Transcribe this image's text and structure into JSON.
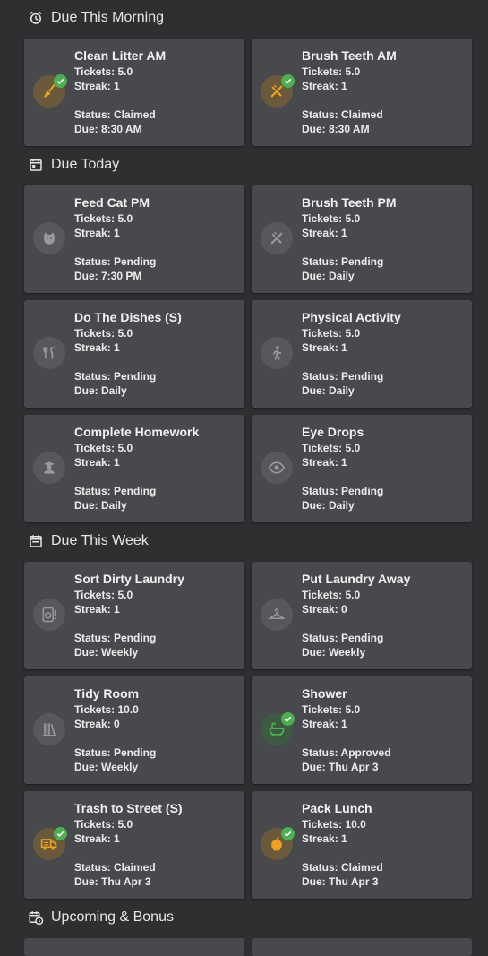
{
  "sections": {
    "morning": {
      "title": "Due This Morning",
      "cards": [
        {
          "title": "Clean Litter AM",
          "tickets": "Tickets: 5.0",
          "streak": "Streak: 1",
          "status": "Status: Claimed",
          "due": "Due: 8:30 AM",
          "icon": "broom-icon"
        },
        {
          "title": "Brush Teeth AM",
          "tickets": "Tickets: 5.0",
          "streak": "Streak: 1",
          "status": "Status: Claimed",
          "due": "Due: 8:30 AM",
          "icon": "toothbrush-icon"
        }
      ]
    },
    "today": {
      "title": "Due Today",
      "cards": [
        {
          "title": "Feed Cat PM",
          "tickets": "Tickets: 5.0",
          "streak": "Streak: 1",
          "status": "Status: Pending",
          "due": "Due: 7:30 PM",
          "icon": "cat-icon"
        },
        {
          "title": "Brush Teeth PM",
          "tickets": "Tickets: 5.0",
          "streak": "Streak: 1",
          "status": "Status: Pending",
          "due": "Due: Daily",
          "icon": "toothbrush-icon"
        },
        {
          "title": "Do The Dishes (S)",
          "tickets": "Tickets: 5.0",
          "streak": "Streak: 1",
          "status": "Status: Pending",
          "due": "Due: Daily",
          "icon": "dishes-icon"
        },
        {
          "title": "Physical Activity",
          "tickets": "Tickets: 5.0",
          "streak": "Streak: 1",
          "status": "Status: Pending",
          "due": "Due: Daily",
          "icon": "walking-icon"
        },
        {
          "title": "Complete Homework",
          "tickets": "Tickets: 5.0",
          "streak": "Streak: 1",
          "status": "Status: Pending",
          "due": "Due: Daily",
          "icon": "student-icon"
        },
        {
          "title": "Eye Drops",
          "tickets": "Tickets: 5.0",
          "streak": "Streak: 1",
          "status": "Status: Pending",
          "due": "Due: Daily",
          "icon": "eye-icon"
        }
      ]
    },
    "week": {
      "title": "Due This Week",
      "cards": [
        {
          "title": "Sort Dirty Laundry",
          "tickets": "Tickets: 5.0",
          "streak": "Streak: 1",
          "status": "Status: Pending",
          "due": "Due: Weekly",
          "icon": "washing-machine-icon"
        },
        {
          "title": "Put Laundry Away",
          "tickets": "Tickets: 5.0",
          "streak": "Streak: 0",
          "status": "Status: Pending",
          "due": "Due: Weekly",
          "icon": "hanger-icon"
        },
        {
          "title": "Tidy Room",
          "tickets": "Tickets: 10.0",
          "streak": "Streak: 0",
          "status": "Status: Pending",
          "due": "Due: Weekly",
          "icon": "books-icon"
        },
        {
          "title": "Shower",
          "tickets": "Tickets: 5.0",
          "streak": "Streak: 1",
          "status": "Status: Approved",
          "due": "Due: Thu Apr 3",
          "icon": "bathtub-icon"
        },
        {
          "title": "Trash to Street (S)",
          "tickets": "Tickets: 5.0",
          "streak": "Streak: 1",
          "status": "Status: Claimed",
          "due": "Due: Thu Apr 3",
          "icon": "truck-icon"
        },
        {
          "title": "Pack Lunch",
          "tickets": "Tickets: 10.0",
          "streak": "Streak: 1",
          "status": "Status: Claimed",
          "due": "Due: Thu Apr 3",
          "icon": "apple-icon"
        }
      ]
    },
    "upcoming": {
      "title": "Upcoming & Bonus"
    }
  },
  "colors": {
    "claimed_icon": "#f0a020",
    "approved_icon": "#4caf50",
    "pending_icon": "#9a9a9a",
    "check_badge": "#4caf50"
  }
}
